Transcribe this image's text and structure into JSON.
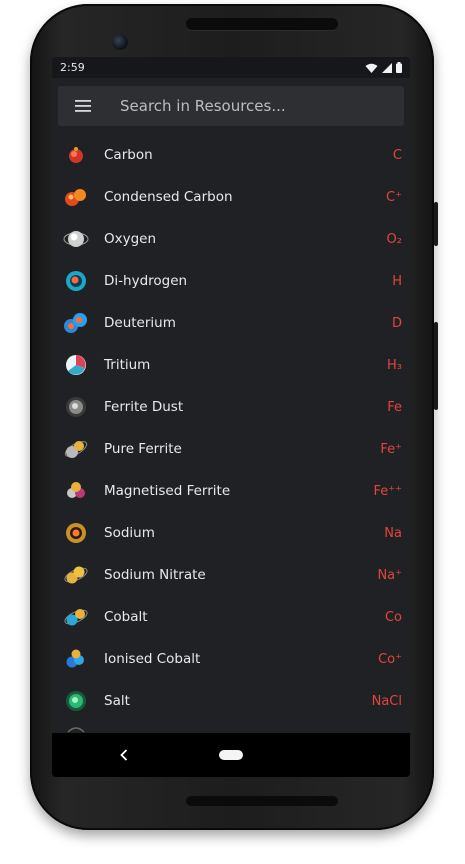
{
  "status": {
    "time": "2:59"
  },
  "search": {
    "placeholder": "Search in Resources..."
  },
  "resources": [
    {
      "name": "Carbon",
      "symbol": "C",
      "icon": "carbon-icon"
    },
    {
      "name": "Condensed Carbon",
      "symbol": "C⁺",
      "icon": "condensed-carbon-icon"
    },
    {
      "name": "Oxygen",
      "symbol": "O₂",
      "icon": "oxygen-icon"
    },
    {
      "name": "Di-hydrogen",
      "symbol": "H",
      "icon": "di-hydrogen-icon"
    },
    {
      "name": "Deuterium",
      "symbol": "D",
      "icon": "deuterium-icon"
    },
    {
      "name": "Tritium",
      "symbol": "H₃",
      "icon": "tritium-icon"
    },
    {
      "name": "Ferrite Dust",
      "symbol": "Fe",
      "icon": "ferrite-dust-icon"
    },
    {
      "name": "Pure Ferrite",
      "symbol": "Fe⁺",
      "icon": "pure-ferrite-icon"
    },
    {
      "name": "Magnetised Ferrite",
      "symbol": "Fe⁺⁺",
      "icon": "magnetised-ferrite-icon"
    },
    {
      "name": "Sodium",
      "symbol": "Na",
      "icon": "sodium-icon"
    },
    {
      "name": "Sodium Nitrate",
      "symbol": "Na⁺",
      "icon": "sodium-nitrate-icon"
    },
    {
      "name": "Cobalt",
      "symbol": "Co",
      "icon": "cobalt-icon"
    },
    {
      "name": "Ionised Cobalt",
      "symbol": "Co⁺",
      "icon": "ionised-cobalt-icon"
    },
    {
      "name": "Salt",
      "symbol": "NaCl",
      "icon": "salt-icon"
    }
  ],
  "colors": {
    "accent": "#e2453a",
    "screen_bg": "#202125",
    "search_bg": "#2e2f33"
  }
}
